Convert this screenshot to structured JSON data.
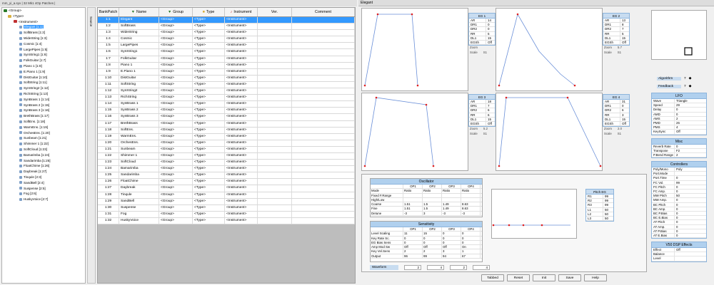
{
  "window_title": "mm_yi_a.syx | 32 Mk1 4Op Patches |",
  "tree": {
    "root": "<Group>",
    "type": "<Type>",
    "instrument": "<Instrument>",
    "items": [
      "Elegant [1:1]",
      "SoftBrass [1:2]",
      "WideString [1:3]",
      "Cosmic [1:4]",
      "LargePipes [1:5]",
      "SynString1 [1:6]",
      "FolkGuitar [1:7]",
      "Piano 1 [1:8]",
      "E.Piano 1 [1:9]",
      "DistGuitar [1:10]",
      "SoftString [1:11]",
      "SynString2 [1:12]",
      "RichString [1:13]",
      "SynBrass 1 [1:14]",
      "SynBrass 2 [1:15]",
      "SynBrass 3 [1:16]",
      "BrethBrass [1:17]",
      "SoftEns. [1:18]",
      "WarmEns. [1:19]",
      "OrchesEns. [1:20]",
      "Sunbeam [1:21]",
      "Shimmer 1 [1:22]",
      "SoftCloud [1:23]",
      "Bamarimba [1:24]",
      "Sandarimba [1:25]",
      "FloatChime [1:26]",
      "Daybreak [1:27]",
      "Tinqule [2:3]",
      "SandBell [2:4]",
      "Suspense [2:5]",
      "Fog [2:6]",
      "HuskyVoice [2:7]"
    ]
  },
  "source_label": "Source",
  "table": {
    "headers": [
      "BankPatch",
      "Name",
      "Group",
      "Type",
      "Instrument",
      "Ver.",
      "Comment"
    ],
    "group_val": "<Group>",
    "type_val": "<Type>",
    "instr_val": "<Instrument>",
    "rows": [
      [
        "1:1",
        "Elegant"
      ],
      [
        "1:2",
        "SoftBrass"
      ],
      [
        "1:3",
        "WideString"
      ],
      [
        "1:4",
        "Cosmic"
      ],
      [
        "1:5",
        "LargePipes"
      ],
      [
        "1:6",
        "SynString1"
      ],
      [
        "1:7",
        "FolkGuitar"
      ],
      [
        "1:8",
        "Piano 1"
      ],
      [
        "1:9",
        "E.Piano 1"
      ],
      [
        "1:10",
        "DistGuitar"
      ],
      [
        "1:11",
        "SoftString"
      ],
      [
        "1:12",
        "SynString2"
      ],
      [
        "1:13",
        "RichString"
      ],
      [
        "1:14",
        "SynBrass 1"
      ],
      [
        "1:15",
        "SynBrass 2"
      ],
      [
        "1:16",
        "SynBrass 3"
      ],
      [
        "1:17",
        "BrethBrass"
      ],
      [
        "1:18",
        "SoftEns."
      ],
      [
        "1:19",
        "WarmEns."
      ],
      [
        "1:20",
        "OrchesEns."
      ],
      [
        "1:21",
        "Sunbeam"
      ],
      [
        "1:22",
        "Shimmer 1"
      ],
      [
        "1:23",
        "SoftCloud"
      ],
      [
        "1:24",
        "Bamarimba"
      ],
      [
        "1:25",
        "Sandarimba"
      ],
      [
        "1:26",
        "FloatChime"
      ],
      [
        "1:27",
        "Daybreak"
      ],
      [
        "1:28",
        "Tinqule"
      ],
      [
        "1:29",
        "SandBell"
      ],
      [
        "1:30",
        "Suspense"
      ],
      [
        "1:31",
        "Fog"
      ],
      [
        "1:32",
        "HuskyVoice"
      ]
    ]
  },
  "editor": {
    "title": "Elegant",
    "egs": [
      {
        "title": "EG 1",
        "params": [
          [
            "AR",
            "14"
          ],
          [
            "DR1",
            "0"
          ],
          [
            "DR2",
            "0"
          ],
          [
            "RR",
            "5"
          ],
          [
            "DL1",
            "15"
          ],
          [
            "EGSh",
            "Off"
          ]
        ],
        "zoom": "",
        "scale": "S1"
      },
      {
        "title": "EG 2",
        "params": [
          [
            "AR",
            "13"
          ],
          [
            "DR1",
            "8"
          ],
          [
            "DR2",
            "7"
          ],
          [
            "RR",
            "5"
          ],
          [
            "DL1",
            "15"
          ],
          [
            "EGSh",
            "Off"
          ]
        ],
        "zoom": "5.7",
        "scale": "S1"
      },
      {
        "title": "EG 3",
        "params": [
          [
            "AR",
            "18"
          ],
          [
            "DR1",
            "7"
          ],
          [
            "DR2",
            "6"
          ],
          [
            "RR",
            "6"
          ],
          [
            "DL1",
            "15"
          ],
          [
            "EGSh",
            "Off"
          ]
        ],
        "zoom": "5.2",
        "scale": "S1"
      },
      {
        "title": "EG 4",
        "params": [
          [
            "AR",
            "31"
          ],
          [
            "DR1",
            "0"
          ],
          [
            "DR2",
            "6"
          ],
          [
            "RR",
            "3"
          ],
          [
            "DL1",
            "15"
          ],
          [
            "EGSh",
            "Off"
          ]
        ],
        "zoom": "2.0",
        "scale": "S1"
      }
    ],
    "zoom_label": "Zoom",
    "scale_label": "Scale",
    "algorithm_label": "Algorithm",
    "algorithm": "7",
    "feedback_label": "Feedback",
    "feedback": "7",
    "oscillator": {
      "title": "Oscillator",
      "cols": [
        "",
        "OP1",
        "OP2",
        "OP3",
        "OP4"
      ],
      "rows": [
        [
          "Mode",
          "Ratio",
          "Ratio",
          "Ratio",
          "Ratio"
        ],
        [
          "Fixed F.Range",
          "",
          "",
          "",
          ""
        ],
        [
          "High/Low",
          "",
          "",
          "",
          ""
        ],
        [
          "Coarse",
          "1.51",
          "1.5",
          "1.49",
          "8.63"
        ],
        [
          "Fine",
          "1.51",
          "1.5",
          "1.49",
          "8.63"
        ],
        [
          "Detune",
          "-3",
          "3",
          "-3",
          "-3"
        ]
      ]
    },
    "sensitivity": {
      "title": "Sensitivity",
      "cols": [
        "",
        "OP1",
        "OP2",
        "OP3",
        "OP4"
      ],
      "rows": [
        [
          "Level Scaling",
          "11",
          "15",
          "0",
          "0"
        ],
        [
          "Key Rate Sc.",
          "0",
          "0",
          "0",
          "0"
        ],
        [
          "EG Bias Sens",
          "0",
          "0",
          "0",
          "0"
        ],
        [
          "Amp Mod Sw",
          "Off",
          "Off",
          "Off",
          "On"
        ],
        [
          "Key Vel.Sens",
          "2",
          "2",
          "3",
          "1"
        ],
        [
          "Output",
          "96",
          "99",
          "94",
          "67"
        ]
      ]
    },
    "waveform_label": "Waveform",
    "waveform_vals": [
      "2",
      "4",
      "2",
      "4"
    ],
    "pitch_eg": {
      "title": "Pitch EG",
      "params": [
        [
          "R1",
          "99"
        ],
        [
          "R2",
          "99"
        ],
        [
          "R3",
          "99"
        ],
        [
          "L1",
          "50"
        ],
        [
          "L2",
          "50"
        ],
        [
          "L3",
          "50"
        ]
      ]
    },
    "lfo": {
      "title": "LFO",
      "params": [
        [
          "Wave",
          "Triangle"
        ],
        [
          "Speed",
          "29"
        ],
        [
          "Delay",
          "0"
        ],
        [
          "AMD",
          "0"
        ],
        [
          "AMS",
          "2"
        ],
        [
          "PMD",
          "26"
        ],
        [
          "PMS",
          "4"
        ],
        [
          "KeySync",
          "Off"
        ]
      ]
    },
    "misc": {
      "title": "Misc",
      "params": [
        [
          "Reverb Rate",
          "0"
        ],
        [
          "Transpose",
          "F2"
        ],
        [
          "P.Bend Range",
          "2"
        ]
      ]
    },
    "controllers": {
      "title": "Controllers",
      "params": [
        [
          "Poly/Mono",
          "Poly"
        ],
        [
          "Port.Mode",
          ""
        ],
        [
          "Port.Time",
          "0"
        ],
        [
          "FC Vol.",
          "99"
        ],
        [
          "FC Pitch",
          "0"
        ],
        [
          "FC Amp.",
          "0"
        ],
        [
          "MW Pitch",
          "50"
        ],
        [
          "MW Amp.",
          "0"
        ],
        [
          "BC Pitch",
          "0"
        ],
        [
          "BC Amp.",
          "0"
        ],
        [
          "BC P.Bias",
          "0"
        ],
        [
          "BC E.Bias",
          "0"
        ],
        [
          "AT Pitch",
          "0"
        ],
        [
          "AT Amp.",
          "0"
        ],
        [
          "AT P.Bias",
          "0"
        ],
        [
          "AT E.Bias",
          "0"
        ]
      ]
    },
    "v50": {
      "title": "V50 DSP Effects",
      "params": [
        [
          "Effect",
          "Off"
        ],
        [
          "Balance",
          ""
        ],
        [
          "Level",
          ""
        ]
      ]
    },
    "buttons": [
      "Tabbed",
      "Reset",
      "Init",
      "Save",
      "Help"
    ]
  }
}
